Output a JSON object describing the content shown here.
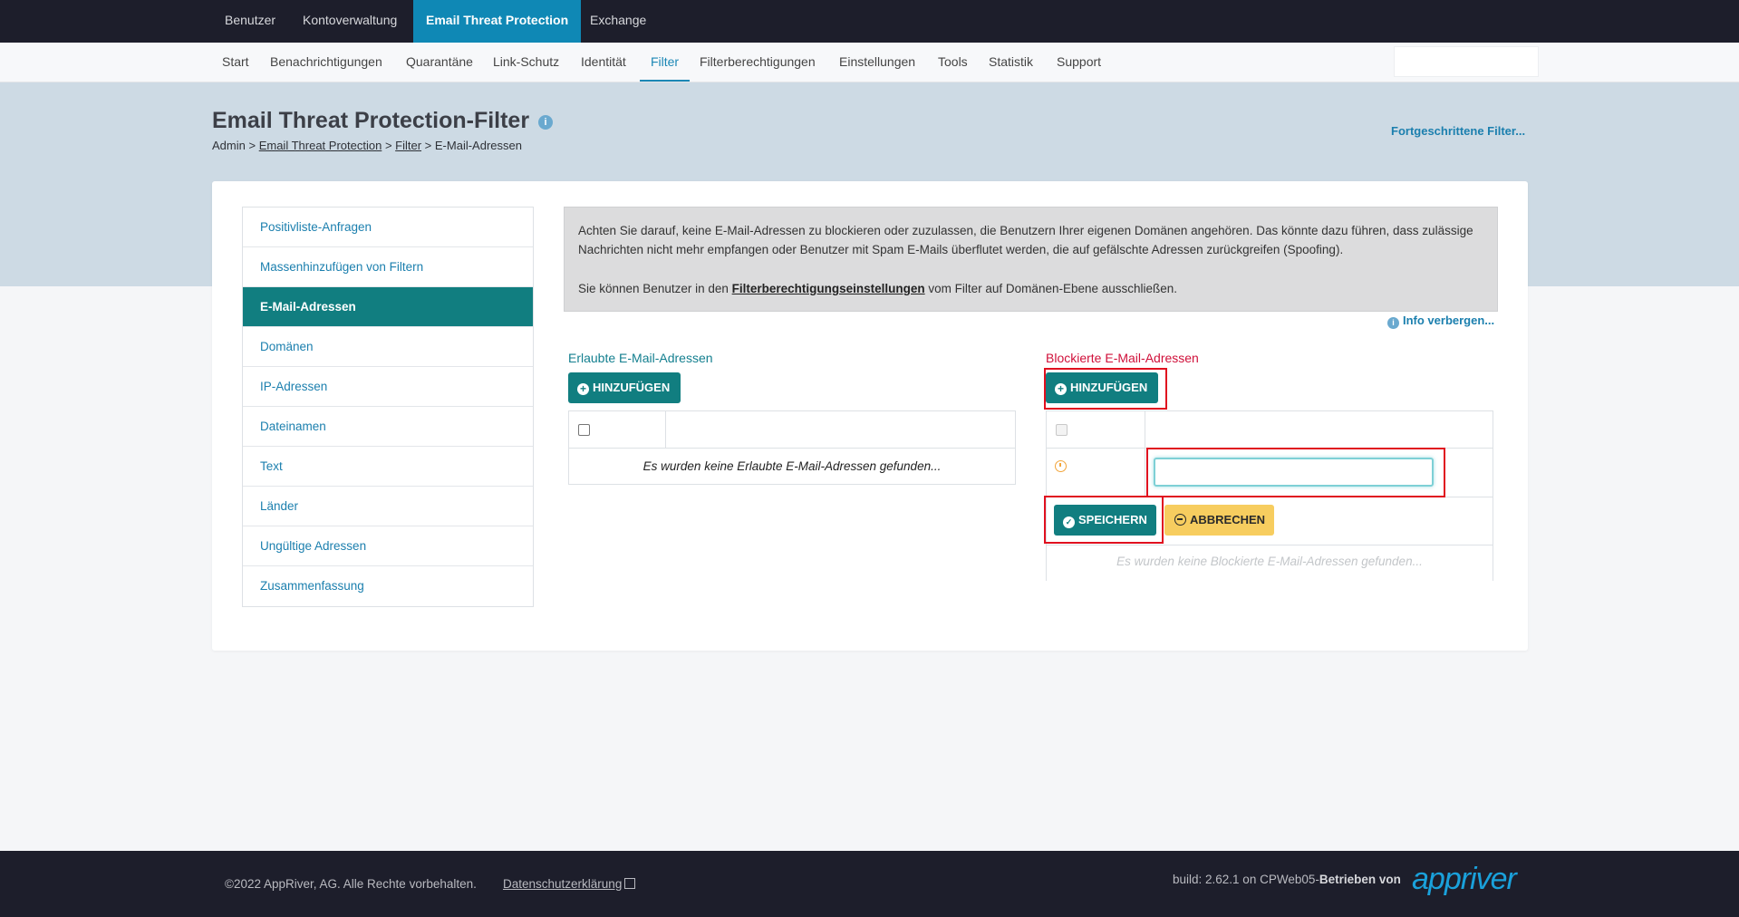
{
  "top_nav": {
    "tabs": [
      {
        "label": "Benutzer"
      },
      {
        "label": "Kontoverwaltung"
      },
      {
        "label": "Email Threat Protection"
      },
      {
        "label": "Exchange"
      }
    ]
  },
  "sub_nav": {
    "items": [
      {
        "label": "Start"
      },
      {
        "label": "Benachrichtigungen"
      },
      {
        "label": "Quarantäne"
      },
      {
        "label": "Link-Schutz"
      },
      {
        "label": "Identität"
      },
      {
        "label": "Filter"
      },
      {
        "label": "Filterberechtigungen"
      },
      {
        "label": "Einstellungen"
      },
      {
        "label": "Tools"
      },
      {
        "label": "Statistik"
      },
      {
        "label": "Support"
      }
    ],
    "search_value": ""
  },
  "header": {
    "title": "Email Threat Protection-Filter",
    "info_icon": "i",
    "breadcrumb": {
      "root": "Admin",
      "sep": ">",
      "link1": "Email Threat Protection",
      "link2": "Filter",
      "current": "E-Mail-Adressen"
    },
    "advanced_filter_link": "Fortgeschrittene Filter..."
  },
  "side_menu": {
    "items": [
      {
        "label": "Positivliste-Anfragen"
      },
      {
        "label": "Massenhinzufügen von Filtern"
      },
      {
        "label": "E-Mail-Adressen"
      },
      {
        "label": "Domänen"
      },
      {
        "label": "IP-Adressen"
      },
      {
        "label": "Dateinamen"
      },
      {
        "label": "Text"
      },
      {
        "label": "Länder"
      },
      {
        "label": "Ungültige Adressen"
      },
      {
        "label": "Zusammenfassung"
      }
    ],
    "active_index": 2
  },
  "notice": {
    "paragraph1": "Achten Sie darauf, keine E-Mail-Adressen zu blockieren oder zuzulassen, die Benutzern Ihrer eigenen Domänen angehören. Das könnte dazu führen, dass zulässige Nachrichten nicht mehr empfangen oder Benutzer mit Spam E-Mails überflutet werden, die auf gefälschte Adressen zurückgreifen (Spoofing).",
    "paragraph2_before": "Sie können Benutzer in den ",
    "paragraph2_link": "Filterberechtigungseinstellungen",
    "paragraph2_after": " vom Filter auf Domänen-Ebene ausschließen.",
    "hide_info_label": "Info verbergen..."
  },
  "allowed": {
    "title": "Erlaubte E-Mail-Adressen",
    "add_button": "HINZUFÜGEN",
    "empty_message": "Es wurden keine Erlaubte E-Mail-Adressen gefunden..."
  },
  "blocked": {
    "title": "Blockierte E-Mail-Adressen",
    "add_button": "HINZUFÜGEN",
    "new_entry_value": "",
    "save_button": "SPEICHERN",
    "cancel_button": "ABBRECHEN",
    "empty_message": "Es wurden keine Blockierte E-Mail-Adressen gefunden..."
  },
  "footer": {
    "copyright": "©2022 AppRiver, AG. Alle Rechte vorbehalten.",
    "privacy_link": "Datenschutzerklärung",
    "build_text": "build: 2.62.1 on CPWeb05-",
    "powered_by": "Betrieben von",
    "logo_text": "appriver"
  },
  "colors": {
    "top_nav_bg": "#1d1e2b",
    "active_tab": "#0f88b5",
    "teal_accent": "#117e80",
    "blocked_title": "#d0103a",
    "cancel_button": "#f7cd5f",
    "highlight_box": "#e0101f"
  }
}
